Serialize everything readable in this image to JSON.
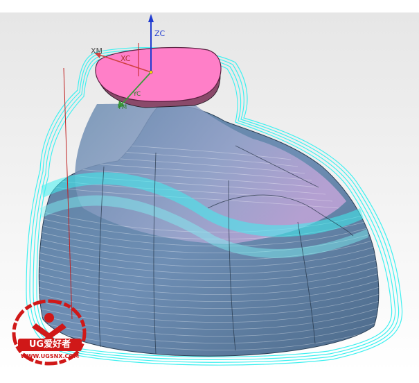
{
  "axes": {
    "zc": "ZC",
    "xc": "XC",
    "xm": "XM",
    "yc": "YC",
    "ym": "YM"
  },
  "watermark": {
    "brand": "UG爱好者",
    "url": "WWW.UGSNX.COM"
  },
  "icons": [
    "triad-icon",
    "watermark-logo-icon"
  ],
  "colors": {
    "toolpath": "#2ee6e6",
    "model_body": "#4a6b8c",
    "top_face": "#ff7fc8",
    "zc_axis": "#1f3bd0",
    "xc_axis": "#d04040",
    "yc_axis": "#3a9a3a",
    "watermark": "#d01818"
  }
}
